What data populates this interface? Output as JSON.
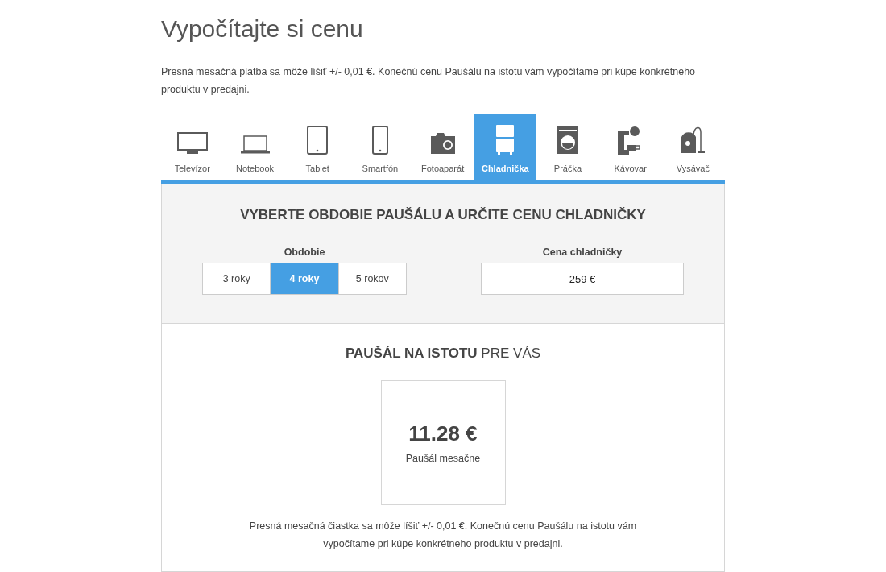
{
  "title": "Vypočítajte si cenu",
  "intro": "Presná mesačná platba sa môže líšiť +/- 0,01 €. Konečnú cenu Paušálu na istotu vám vypočítame pri kúpe konkrétneho produktu v predajni.",
  "tabs": [
    {
      "label": "Televízor",
      "kind": "tv",
      "selected": false
    },
    {
      "label": "Notebook",
      "kind": "laptop",
      "selected": false
    },
    {
      "label": "Tablet",
      "kind": "tablet",
      "selected": false
    },
    {
      "label": "Smartfón",
      "kind": "phone",
      "selected": false
    },
    {
      "label": "Fotoaparát",
      "kind": "camera",
      "selected": false
    },
    {
      "label": "Chladnička",
      "kind": "fridge",
      "selected": true
    },
    {
      "label": "Práčka",
      "kind": "washer",
      "selected": false
    },
    {
      "label": "Kávovar",
      "kind": "coffee",
      "selected": false
    },
    {
      "label": "Vysávač",
      "kind": "vacuum",
      "selected": false
    }
  ],
  "config": {
    "heading": "VYBERTE OBDOBIE PAUŠÁLU A URČITE CENU CHLADNIČKY",
    "period_label": "Obdobie",
    "periods": [
      {
        "label": "3 roky",
        "selected": false
      },
      {
        "label": "4 roky",
        "selected": true
      },
      {
        "label": "5 rokov",
        "selected": false
      }
    ],
    "price_label": "Cena chladničky",
    "price_value": "259 €"
  },
  "result": {
    "heading": "**PAUŠÁL NA ISTOTU** PRE VÁS",
    "amount": "11.28 €",
    "amount_caption": "Paušál mesačne",
    "note": "Presná mesačná čiastka sa môže líšiť +/- 0,01 €. Konečnú cenu Paušálu na istotu vám vypočítame pri kúpe konkrétneho produktu v predajni."
  }
}
